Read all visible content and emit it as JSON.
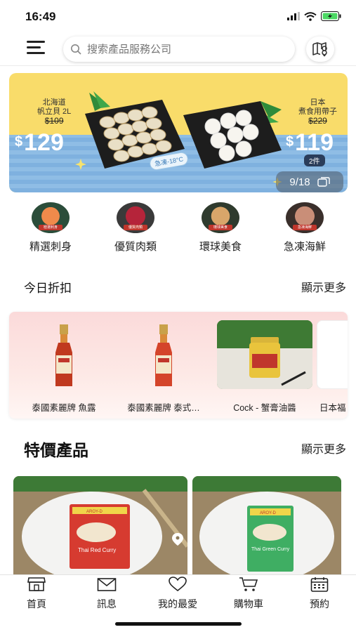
{
  "status_bar": {
    "time": "16:49"
  },
  "search": {
    "placeholder": "搜索產品服務公司"
  },
  "banner": {
    "left_product_line1": "北海道",
    "left_product_line2": "帆立貝 2L",
    "left_old_price": "$109",
    "left_price": "129",
    "currency": "$",
    "right_product_line1": "日本",
    "right_product_line2": "煮食用帶子",
    "right_old_price": "$229",
    "right_price": "119",
    "right_qty": "2件",
    "temp_tag": "急凍-18°C",
    "page": "9/18"
  },
  "categories": [
    {
      "label": "精選刺身",
      "icon": "sashimi-icon",
      "tag": "極選刺身"
    },
    {
      "label": "優質肉類",
      "icon": "meat-icon",
      "tag": "優質肉類"
    },
    {
      "label": "環球美食",
      "icon": "global-food-icon",
      "tag": "環球美食"
    },
    {
      "label": "急凍海鮮",
      "icon": "frozen-seafood-icon",
      "tag": "急凍海鮮"
    }
  ],
  "discount_section": {
    "title": "今日折扣",
    "more": "顯示更多",
    "items": [
      {
        "name": "泰國素麗牌 魚露"
      },
      {
        "name": "泰國素麗牌 泰式…"
      },
      {
        "name": "Cock - 蟹膏油醬"
      },
      {
        "name": "日本福"
      }
    ]
  },
  "special_section": {
    "title": "特價產品",
    "more": "顯示更多",
    "products": [
      {
        "package_text": "Thai Red Curry",
        "brand": "AROY-D"
      },
      {
        "package_text": "Thai Green Curry",
        "brand": "AROY-D"
      }
    ]
  },
  "tabbar": {
    "items": [
      {
        "label": "首頁",
        "icon": "store-icon"
      },
      {
        "label": "訊息",
        "icon": "mail-icon"
      },
      {
        "label": "我的最愛",
        "icon": "heart-icon"
      },
      {
        "label": "購物車",
        "icon": "cart-icon"
      },
      {
        "label": "預約",
        "icon": "calendar-icon"
      }
    ]
  },
  "colors": {
    "banner_yellow": "#f9dc6a",
    "banner_blue": "#7fb1df",
    "discount_bg": "#fbdada",
    "sale_red": "#c0362c"
  }
}
